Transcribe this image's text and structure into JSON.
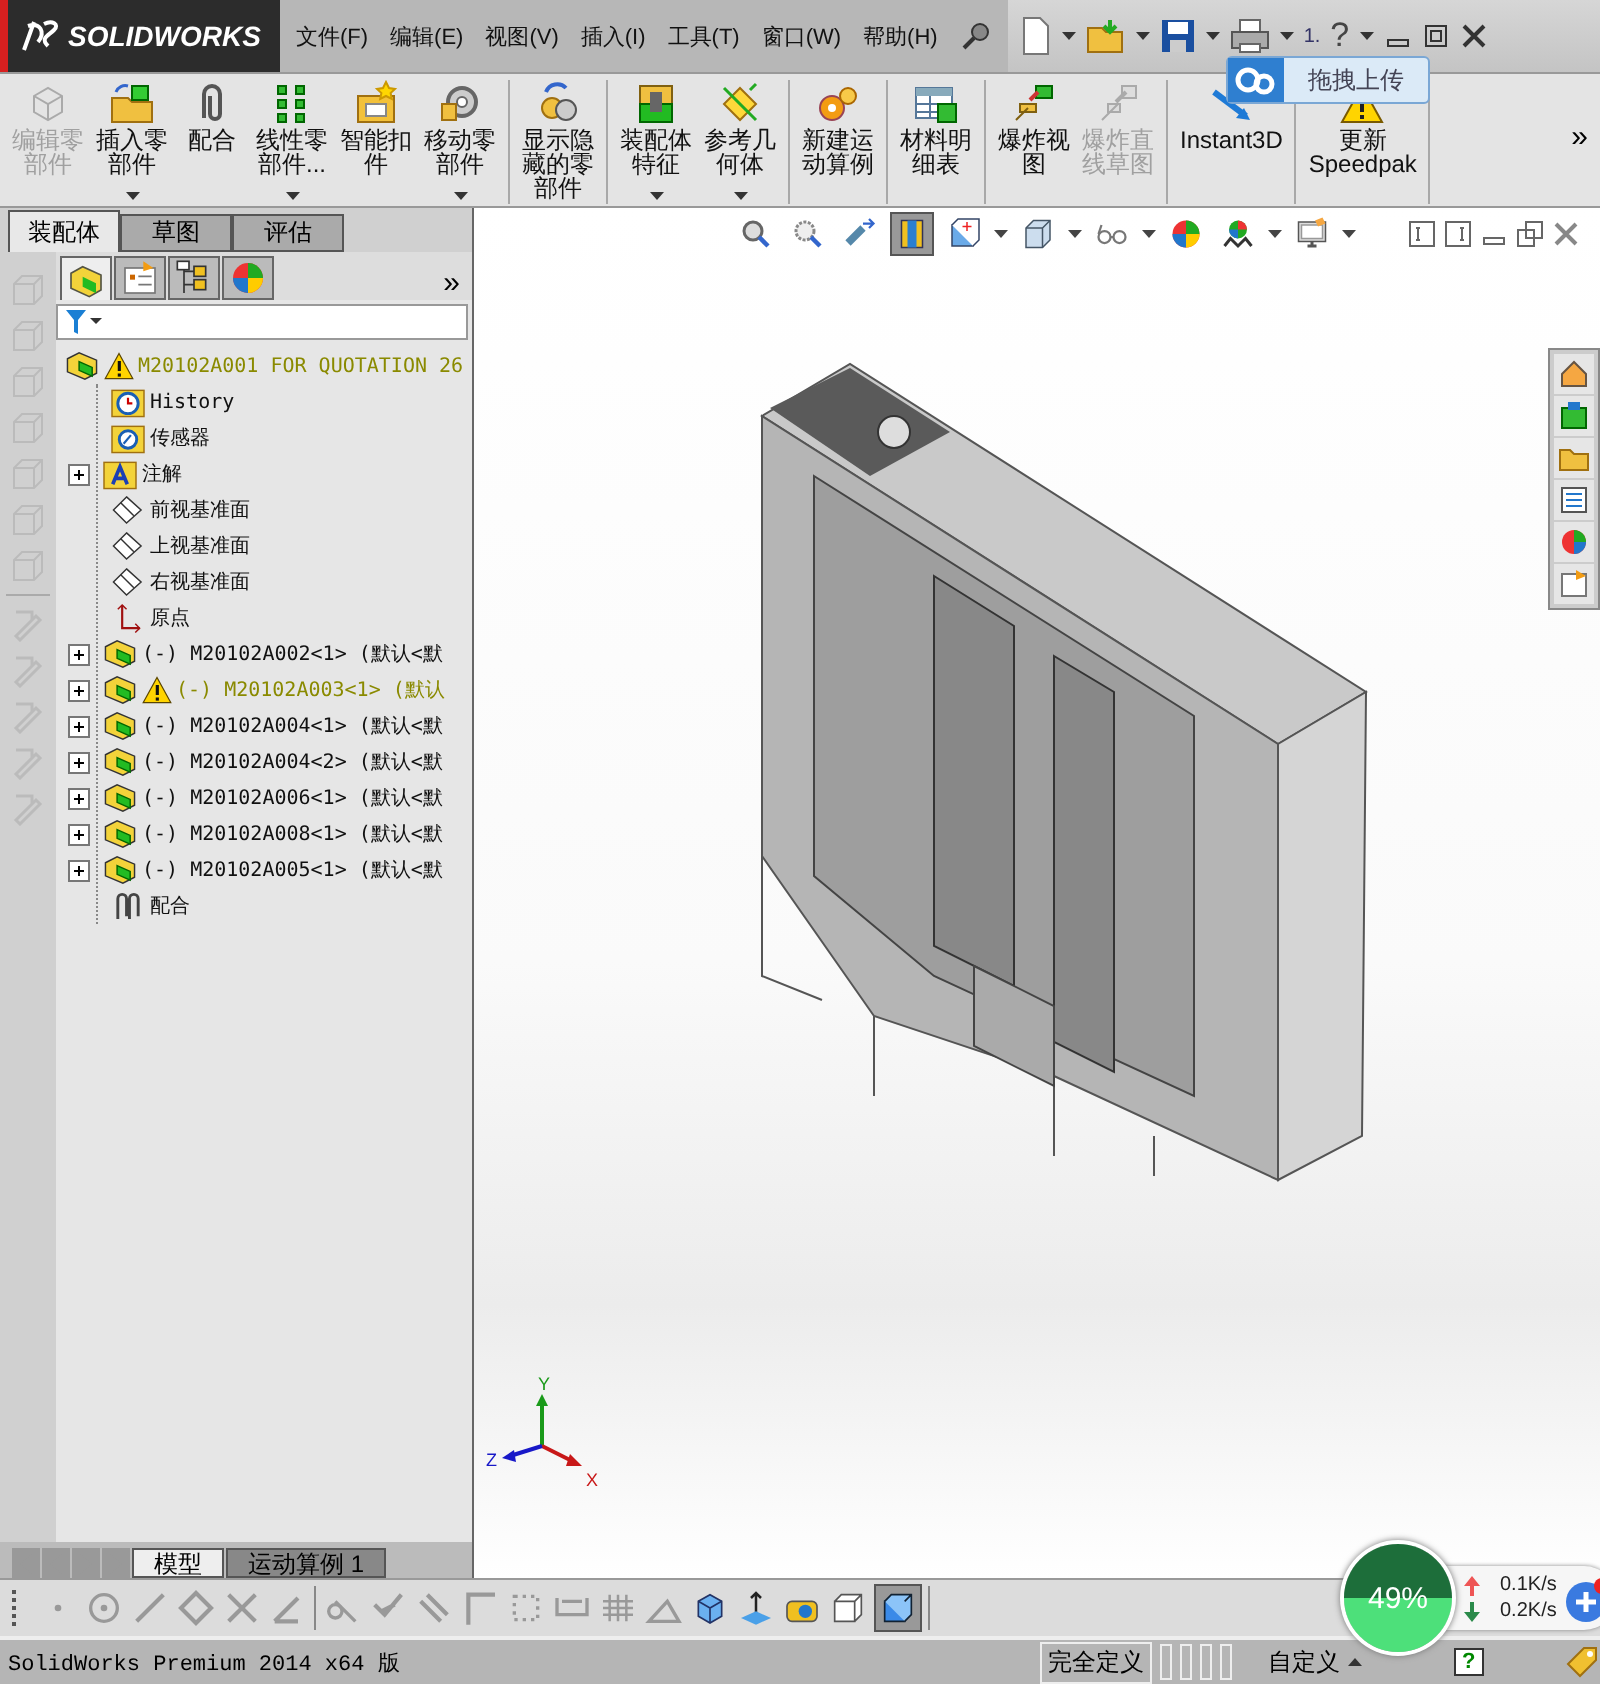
{
  "app": {
    "logo": "SOLIDWORKS"
  },
  "menu": [
    "文件(F)",
    "编辑(E)",
    "视图(V)",
    "插入(I)",
    "工具(T)",
    "窗口(W)",
    "帮助(H)"
  ],
  "quick_access": {
    "text": "1.",
    "help": "?"
  },
  "upload_tip": "拖拽上传",
  "ribbon": {
    "groups": [
      [
        {
          "lines": [
            "编辑零",
            "部件"
          ],
          "disabled": true,
          "dropdown": false
        },
        {
          "lines": [
            "插入零",
            "部件"
          ],
          "disabled": false,
          "dropdown": true
        },
        {
          "lines": [
            "配合"
          ],
          "disabled": false,
          "dropdown": false
        },
        {
          "lines": [
            "线性零",
            "部件..."
          ],
          "disabled": false,
          "dropdown": true
        },
        {
          "lines": [
            "智能扣",
            "件"
          ],
          "disabled": false,
          "dropdown": false
        },
        {
          "lines": [
            "移动零",
            "部件"
          ],
          "disabled": false,
          "dropdown": true
        }
      ],
      [
        {
          "lines": [
            "显示隐",
            "藏的零",
            "部件"
          ],
          "disabled": false,
          "dropdown": false
        }
      ],
      [
        {
          "lines": [
            "装配体",
            "特征"
          ],
          "disabled": false,
          "dropdown": true
        },
        {
          "lines": [
            "参考几",
            "何体"
          ],
          "disabled": false,
          "dropdown": true
        }
      ],
      [
        {
          "lines": [
            "新建运",
            "动算例"
          ],
          "disabled": false,
          "dropdown": false
        }
      ],
      [
        {
          "lines": [
            "材料明",
            "细表"
          ],
          "disabled": false,
          "dropdown": false
        }
      ],
      [
        {
          "lines": [
            "爆炸视",
            "图"
          ],
          "disabled": false,
          "dropdown": false
        },
        {
          "lines": [
            "爆炸直",
            "线草图"
          ],
          "disabled": true,
          "dropdown": false
        }
      ],
      [
        {
          "lines": [
            "Instant3D"
          ],
          "disabled": false,
          "dropdown": false
        }
      ],
      [
        {
          "lines": [
            "更新",
            "Speedpak"
          ],
          "disabled": false,
          "dropdown": false
        }
      ]
    ],
    "more": "»"
  },
  "command_tabs": [
    {
      "label": "装配体",
      "selected": true
    },
    {
      "label": "草图",
      "selected": false
    },
    {
      "label": "评估",
      "selected": false
    }
  ],
  "manager_tabs": [
    {
      "selected": true
    },
    {
      "selected": false
    },
    {
      "selected": false
    },
    {
      "selected": false
    }
  ],
  "manager_more": "»",
  "tree": {
    "root": {
      "kind": "assembly",
      "label": "M20102A001 FOR QUOTATION 26",
      "warning": true,
      "children": [
        {
          "kind": "history",
          "label": "History",
          "warning": false
        },
        {
          "kind": "sensors",
          "label": "传感器",
          "warning": false
        },
        {
          "kind": "annotations",
          "label": "注解",
          "warning": false,
          "expanded": false
        },
        {
          "kind": "plane",
          "label": "前视基准面",
          "warning": false
        },
        {
          "kind": "plane",
          "label": "上视基准面",
          "warning": false
        },
        {
          "kind": "plane",
          "label": "右视基准面",
          "warning": false
        },
        {
          "kind": "origin",
          "label": "原点",
          "warning": false
        },
        {
          "kind": "component",
          "label": "(-) M20102A002<1> (默认<默",
          "warning": false,
          "expanded": false
        },
        {
          "kind": "component",
          "label": "(-) M20102A003<1> (默认",
          "warning": true,
          "expanded": false
        },
        {
          "kind": "component",
          "label": "(-) M20102A004<1> (默认<默",
          "warning": false,
          "expanded": false
        },
        {
          "kind": "component",
          "label": "(-) M20102A004<2> (默认<默",
          "warning": false,
          "expanded": false
        },
        {
          "kind": "component",
          "label": "(-) M20102A006<1> (默认<默",
          "warning": false,
          "expanded": false
        },
        {
          "kind": "component",
          "label": "(-) M20102A008<1> (默认<默",
          "warning": false,
          "expanded": false
        },
        {
          "kind": "component",
          "label": "(-) M20102A005<1> (默认<默",
          "warning": false,
          "expanded": false
        },
        {
          "kind": "mates",
          "label": "配合",
          "warning": false
        }
      ]
    }
  },
  "heads_up_toolbar": {
    "section_view_pressed": true
  },
  "triad": {
    "x": "X",
    "y": "Y",
    "z": "Z"
  },
  "bottom_tabs": [
    {
      "label": "模型",
      "selected": true
    },
    {
      "label": "运动算例 1",
      "selected": false
    }
  ],
  "sketch_toolbar": {
    "shaded_pressed": true
  },
  "status_bar": {
    "text": "SolidWorks Premium 2014 x64 版",
    "state": "完全定义",
    "units": "自定义",
    "help": "?"
  },
  "network": {
    "percent": "49%",
    "upload": "0.1K/s",
    "download": "0.2K/s"
  }
}
